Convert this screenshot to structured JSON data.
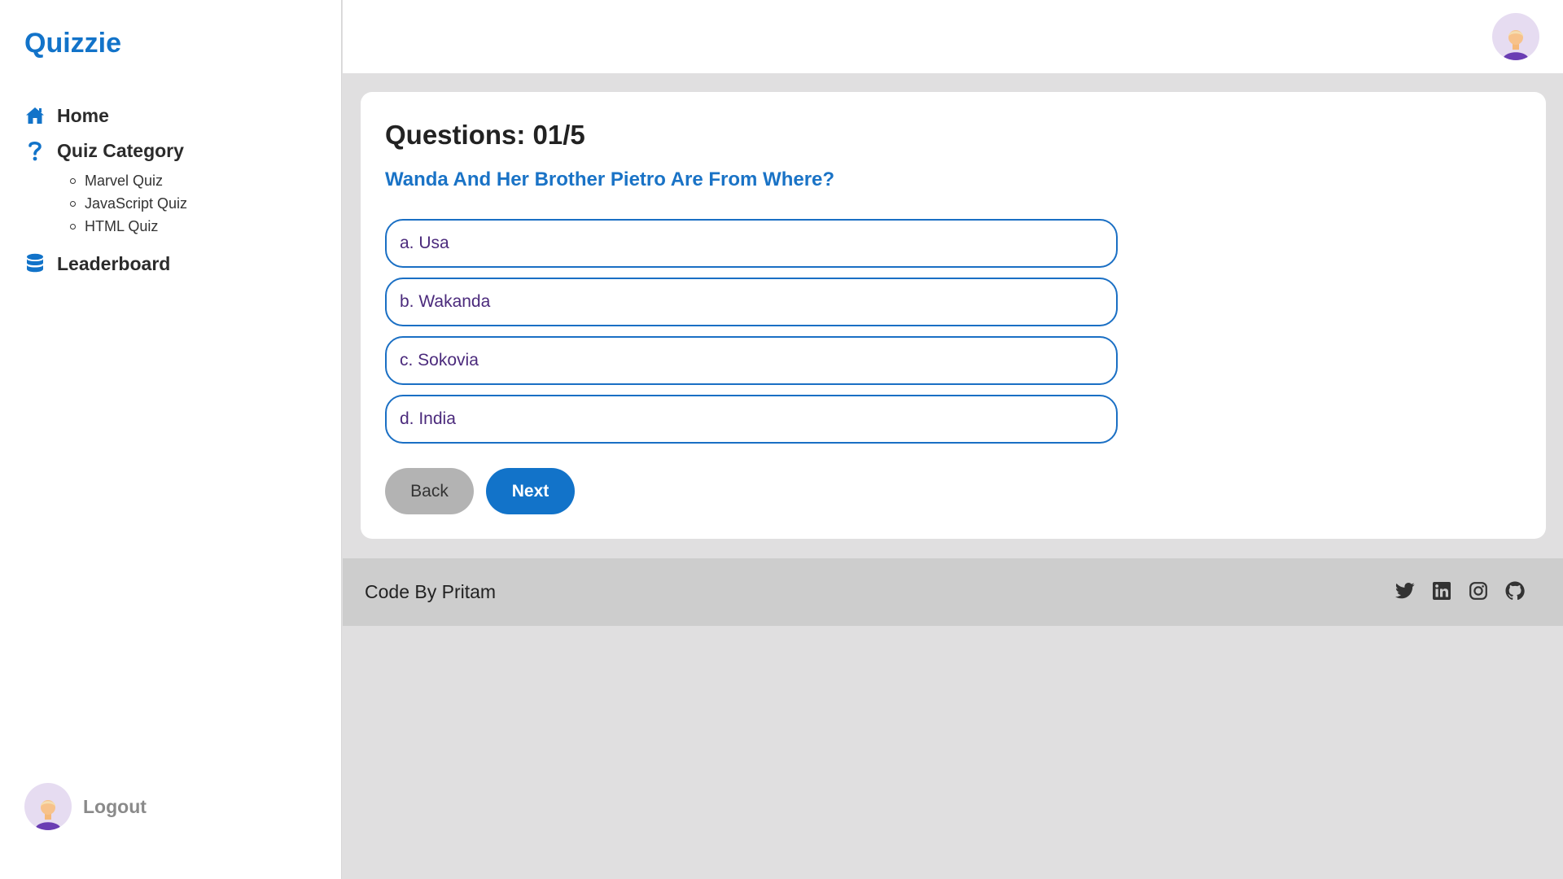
{
  "app": {
    "brand": "Quizzie"
  },
  "sidebar": {
    "items": [
      {
        "label": "Home",
        "icon": "home-icon"
      },
      {
        "label": "Quiz Category",
        "icon": "question-icon"
      },
      {
        "label": "Leaderboard",
        "icon": "database-icon"
      }
    ],
    "sub_items": [
      "Marvel Quiz",
      "JavaScript Quiz",
      "HTML Quiz"
    ],
    "logout_label": "Logout"
  },
  "quiz": {
    "count": "Questions: 01/5",
    "question": "Wanda And Her Brother Pietro Are From Where?",
    "options": [
      "a. Usa",
      "b. Wakanda",
      "c. Sokovia",
      "d. India"
    ],
    "back_label": "Back",
    "next_label": "Next"
  },
  "footer": {
    "credit": "Code By Pritam",
    "social_icons": [
      "twitter-icon",
      "linkedin-icon",
      "instagram-icon",
      "github-icon"
    ]
  },
  "colors": {
    "accent": "#1273c9",
    "option_text": "#4b2a7c",
    "back_button": "#b3b3b3",
    "footer_bg": "#cdcdcd",
    "page_bg": "#e0dfe0"
  }
}
